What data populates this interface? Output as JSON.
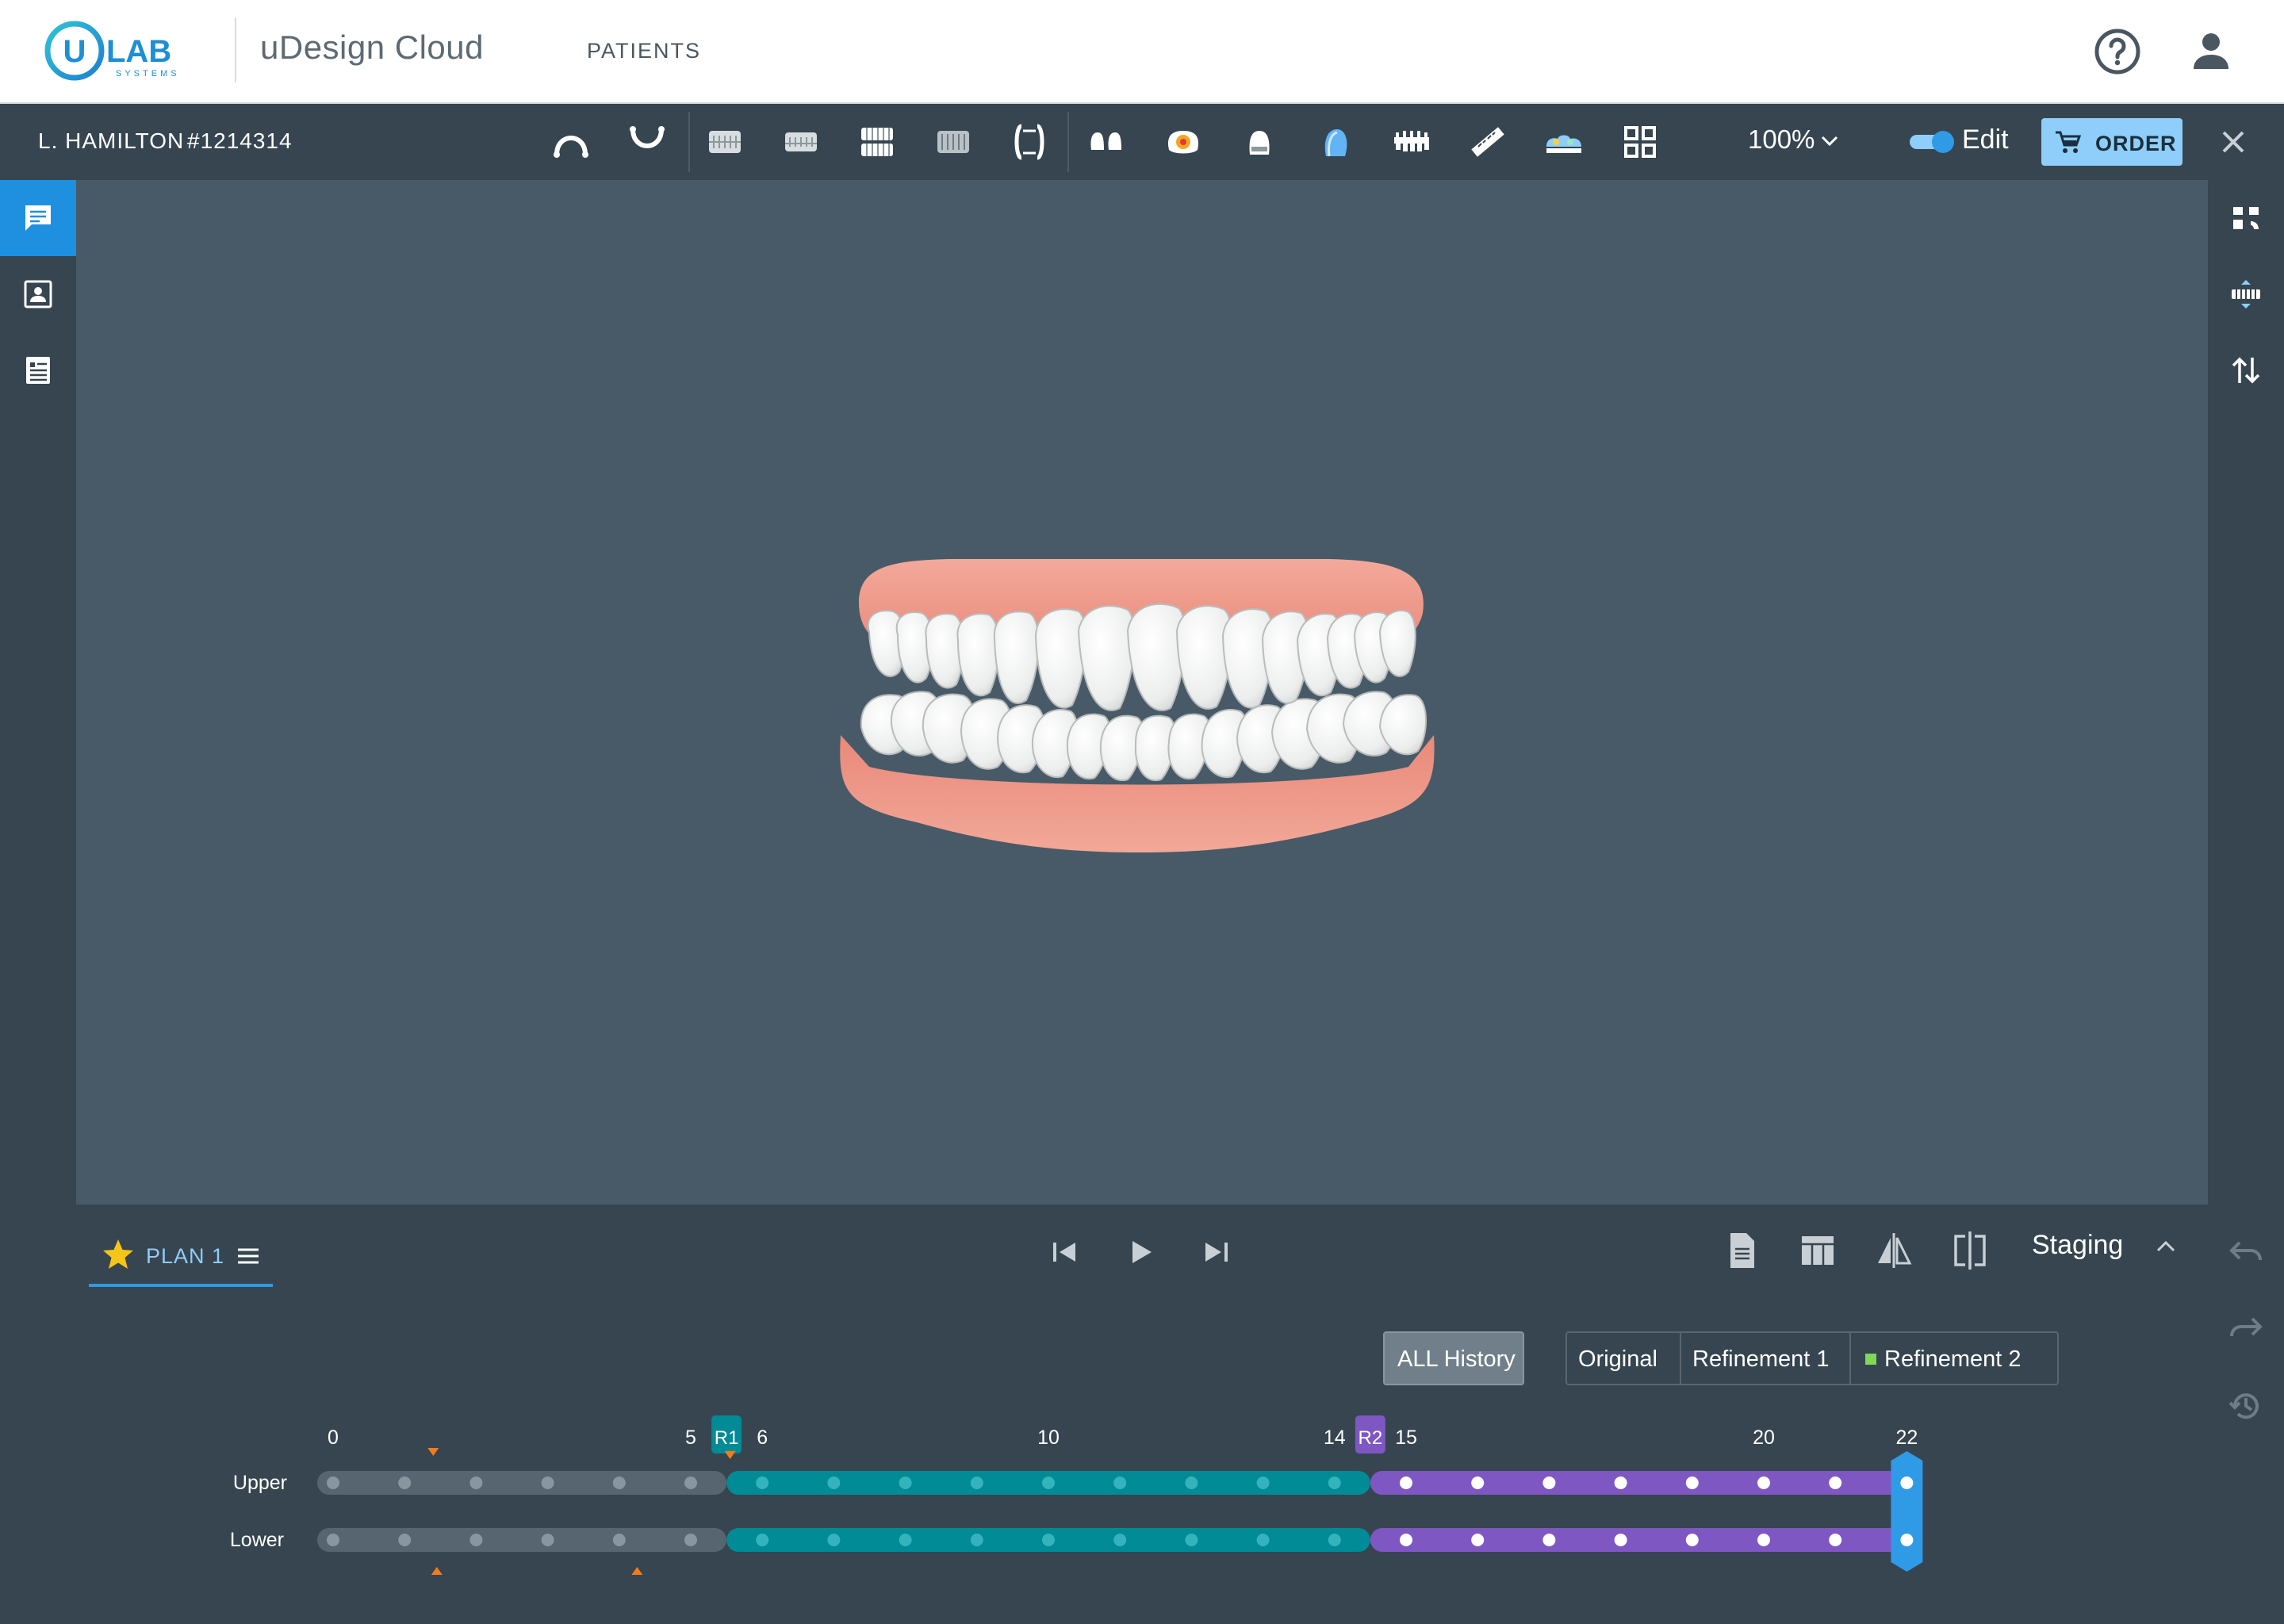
{
  "header": {
    "logo_text": "ULAB",
    "logo_sub": "SYSTEMS",
    "app_title": "uDesign Cloud",
    "nav_patients": "PATIENTS"
  },
  "toolbar": {
    "patient_name": "L. HAMILTON",
    "patient_id": "#1214314",
    "zoom": "100%",
    "edit_label": "Edit",
    "order_label": "ORDER"
  },
  "plan": {
    "tab_label": "PLAN 1",
    "staging_label": "Staging"
  },
  "history_filter": {
    "all_label": "ALL History",
    "segments": [
      "Original",
      "Refinement 1",
      "Refinement 2"
    ]
  },
  "timeline": {
    "tick_labels": [
      "0",
      "5",
      "6",
      "10",
      "14",
      "15",
      "20",
      "22"
    ],
    "tick_steps": [
      0,
      5,
      6,
      10,
      14,
      15,
      20,
      22
    ],
    "refinement_markers": [
      {
        "label": "R1",
        "step": 5.5
      },
      {
        "label": "R2",
        "step": 14.5
      }
    ],
    "rows": [
      "Upper",
      "Lower"
    ],
    "current_step": 22,
    "total_steps": 22,
    "colors": {
      "original": "#56656f",
      "refinement1": "#008b96",
      "refinement2": "#7e57c2",
      "current": "#2f9ae6",
      "marker": "#f27c1a"
    }
  },
  "icons": {
    "toolbar": [
      "upper-arch-icon",
      "lower-arch-icon",
      "front-view-icon",
      "bite-view-icon",
      "both-arches-icon",
      "lower-teeth-view-icon",
      "occlusal-view-icon",
      "tooth-pair-icon",
      "collision-map-icon",
      "single-tooth-icon",
      "crown-icon",
      "aligner-icon",
      "ruler-icon",
      "superimpose-icon",
      "grid-view-icon"
    ],
    "left_rail": [
      "chat-icon",
      "patient-card-icon",
      "records-icon"
    ],
    "right_rail": [
      "arch-layout-icon",
      "bite-adjust-icon",
      "sort-arrows-icon"
    ]
  }
}
